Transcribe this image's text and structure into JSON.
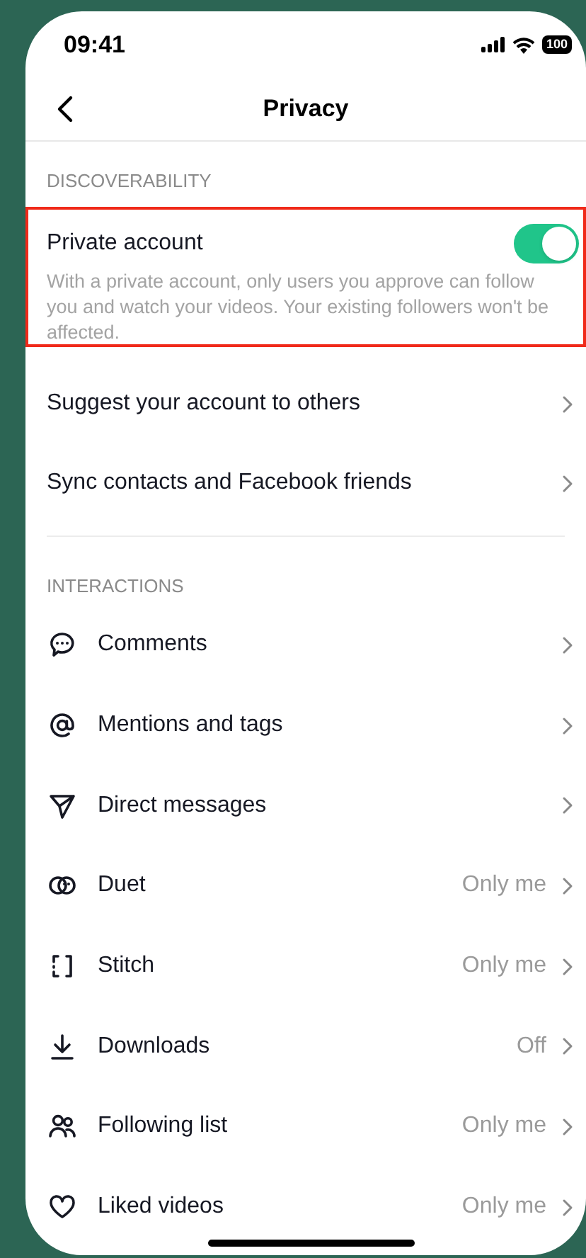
{
  "status_bar": {
    "time": "09:41",
    "battery": "100"
  },
  "header": {
    "title": "Privacy"
  },
  "discoverability": {
    "heading": "DISCOVERABILITY",
    "private_account": {
      "label": "Private account",
      "on": true,
      "highlighted": true,
      "description": "With a private account, only users you approve can follow you and watch your videos. Your existing followers won't be affected."
    },
    "items": [
      {
        "label": "Suggest your account to others"
      },
      {
        "label": "Sync contacts and Facebook friends"
      }
    ]
  },
  "interactions": {
    "heading": "INTERACTIONS",
    "items": [
      {
        "label": "Comments"
      },
      {
        "label": "Mentions and tags"
      },
      {
        "label": "Direct messages"
      },
      {
        "label": "Duet",
        "value": "Only me"
      },
      {
        "label": "Stitch",
        "value": "Only me"
      },
      {
        "label": "Downloads",
        "value": "Off"
      },
      {
        "label": "Following list",
        "value": "Only me"
      },
      {
        "label": "Liked videos",
        "value": "Only me"
      }
    ]
  }
}
